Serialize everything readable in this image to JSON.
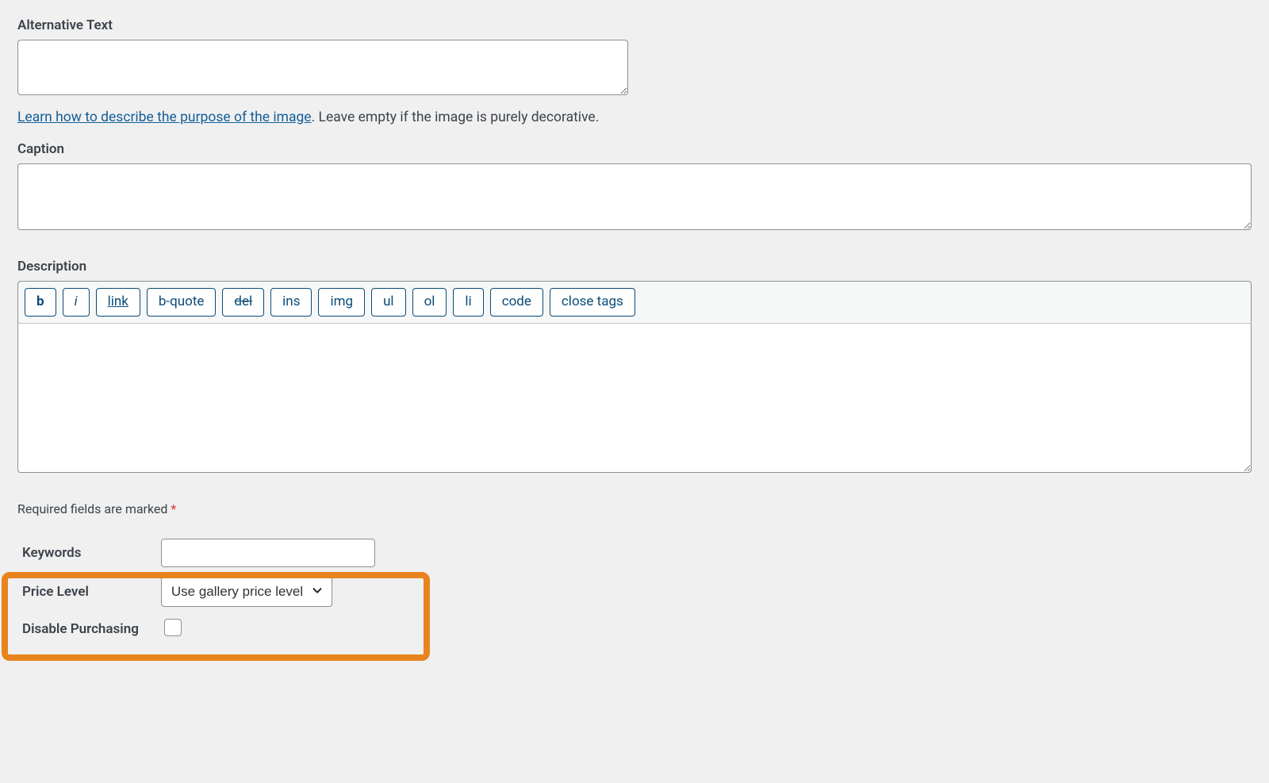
{
  "alt_text": {
    "label": "Alternative Text",
    "value": "",
    "help_link_text": "Learn how to describe the purpose of the image",
    "help_suffix": ". Leave empty if the image is purely decorative."
  },
  "caption": {
    "label": "Caption",
    "value": ""
  },
  "description": {
    "label": "Description",
    "value": "",
    "toolbar": {
      "b": "b",
      "i": "i",
      "link": "link",
      "bquote": "b-quote",
      "del": "del",
      "ins": "ins",
      "img": "img",
      "ul": "ul",
      "ol": "ol",
      "li": "li",
      "code": "code",
      "close": "close tags"
    }
  },
  "required_note": {
    "text": "Required fields are marked ",
    "star": "*"
  },
  "keywords": {
    "label": "Keywords",
    "value": ""
  },
  "price_level": {
    "label": "Price Level",
    "selected": "Use gallery price level"
  },
  "disable_purchasing": {
    "label": "Disable Purchasing",
    "checked": false
  }
}
